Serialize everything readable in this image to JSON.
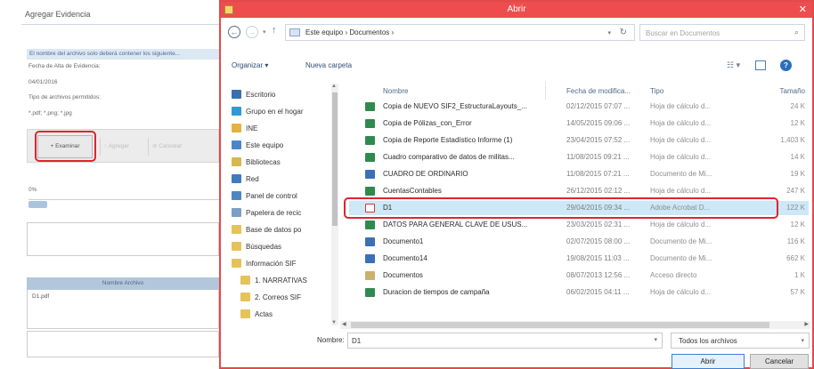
{
  "background_panel": {
    "title": "Agregar Evidencia",
    "note": "El nombre del archivo solo deberá contener los siguiente...",
    "date_label": "Fecha de Alta de Evidencia:",
    "date_value": "04/01/2016",
    "types_label": "Tipo de archivos permitidos:",
    "types_value": "*.pdf; *.png; *.jpg",
    "examinar_label": "+ Examinar",
    "agregar_label": "↑ Agregar",
    "cancelar_label": "⊘ Cancelar",
    "percent_label": "0%",
    "progress_fraction": 0.1,
    "files_header": "Nombre Archivo",
    "file_name": "D1.pdf"
  },
  "dialog": {
    "title": "Abrir",
    "path": "Este equipo  ›  Documentos  ›",
    "search_placeholder": "Buscar en Documentos",
    "organize_label": "Organizar ▾",
    "new_folder_label": "Nueva carpeta",
    "columns": {
      "name": "Nombre",
      "date": "Fecha de modifica...",
      "type": "Tipo",
      "size": "Tamaño"
    },
    "nav_items": [
      {
        "label": "Escritorio",
        "icon": "desktop-icon",
        "color": "#3a6fb0"
      },
      {
        "label": "Grupo en el hogar",
        "icon": "homegroup-icon",
        "color": "#2f9ad6"
      },
      {
        "label": "INE",
        "icon": "user-folder-icon",
        "color": "#e3b341"
      },
      {
        "label": "Este equipo",
        "icon": "computer-icon",
        "color": "#4a86c8"
      },
      {
        "label": "Bibliotecas",
        "icon": "libraries-icon",
        "color": "#d9b64e"
      },
      {
        "label": "Red",
        "icon": "network-icon",
        "color": "#3f7bbf"
      },
      {
        "label": "Panel de control",
        "icon": "control-panel-icon",
        "color": "#4e86c2"
      },
      {
        "label": "Papelera de recic",
        "icon": "recycle-bin-icon",
        "color": "#7c9fc5"
      },
      {
        "label": "Base de datos po",
        "icon": "folder-icon",
        "color": "#e5c25a"
      },
      {
        "label": "Búsquedas",
        "icon": "folder-icon",
        "color": "#e5c25a"
      },
      {
        "label": "Información SIF",
        "icon": "folder-icon",
        "color": "#e5c25a"
      },
      {
        "label": "1. NARRATIVAS",
        "icon": "folder-icon",
        "color": "#e5c25a"
      },
      {
        "label": "2. Correos SIF",
        "icon": "folder-icon",
        "color": "#e5c25a"
      },
      {
        "label": "Actas",
        "icon": "folder-icon",
        "color": "#e5c25a"
      }
    ],
    "files": [
      {
        "name": "Copia de NUEVO SIF2_EstructuraLayouts_...",
        "date": "02/12/2015 07:07 ...",
        "type": "Hoja de cálculo d...",
        "size": "24 K",
        "icon": "excel-icon"
      },
      {
        "name": "Copia de Pólizas_con_Error",
        "date": "14/05/2015 09:06 ...",
        "type": "Hoja de cálculo d...",
        "size": "12 K",
        "icon": "excel-icon"
      },
      {
        "name": "Copia de Reporte Estadístico Informe (1)",
        "date": "23/04/2015 07:52 ...",
        "type": "Hoja de cálculo d...",
        "size": "1,403 K",
        "icon": "excel-icon"
      },
      {
        "name": "Cuadro comparativo de  datos de militas...",
        "date": "11/08/2015 09:21 ...",
        "type": "Hoja de cálculo d...",
        "size": "14 K",
        "icon": "excel-icon"
      },
      {
        "name": "CUADRO DE ORDINARIO",
        "date": "11/08/2015 07:21 ...",
        "type": "Documento de Mi...",
        "size": "19 K",
        "icon": "word-icon"
      },
      {
        "name": "CuentasContables",
        "date": "26/12/2015 02:12 ...",
        "type": "Hoja de cálculo d...",
        "size": "247 K",
        "icon": "excel-icon"
      },
      {
        "name": "D1",
        "date": "29/04/2015 09:34 ...",
        "type": "Adobe Acrobat D...",
        "size": "122 K",
        "icon": "pdf-icon"
      },
      {
        "name": "DATOS PARA  GENERAL CLAVE DE USUS...",
        "date": "23/03/2015 02:31 ...",
        "type": "Hoja de cálculo d...",
        "size": "12 K",
        "icon": "excel-icon"
      },
      {
        "name": "Documento1",
        "date": "02/07/2015 08:00 ...",
        "type": "Documento de Mi...",
        "size": "116 K",
        "icon": "word-icon"
      },
      {
        "name": "Documento14",
        "date": "19/08/2015 11:03 ...",
        "type": "Documento de Mi...",
        "size": "662 K",
        "icon": "word-icon"
      },
      {
        "name": "Documentos",
        "date": "08/07/2013 12:56 ...",
        "type": "Acceso directo",
        "size": "1 K",
        "icon": "shortcut-icon"
      },
      {
        "name": "Duracion de tiempos de campaña",
        "date": "06/02/2015 04:11 ...",
        "type": "Hoja de cálculo d...",
        "size": "57 K",
        "icon": "excel-icon"
      }
    ],
    "selected_index": 6,
    "filename_label": "Nombre:",
    "filename_value": "D1",
    "filetype_value": "Todos los archivos",
    "open_label": "Abrir",
    "cancel_label": "Cancelar"
  },
  "colors": {
    "titlebar": "#ee4d4d",
    "highlight": "#e0242f",
    "selection": "#cde8f7",
    "excel": "#2f8a4d",
    "word": "#3c6fb5"
  }
}
